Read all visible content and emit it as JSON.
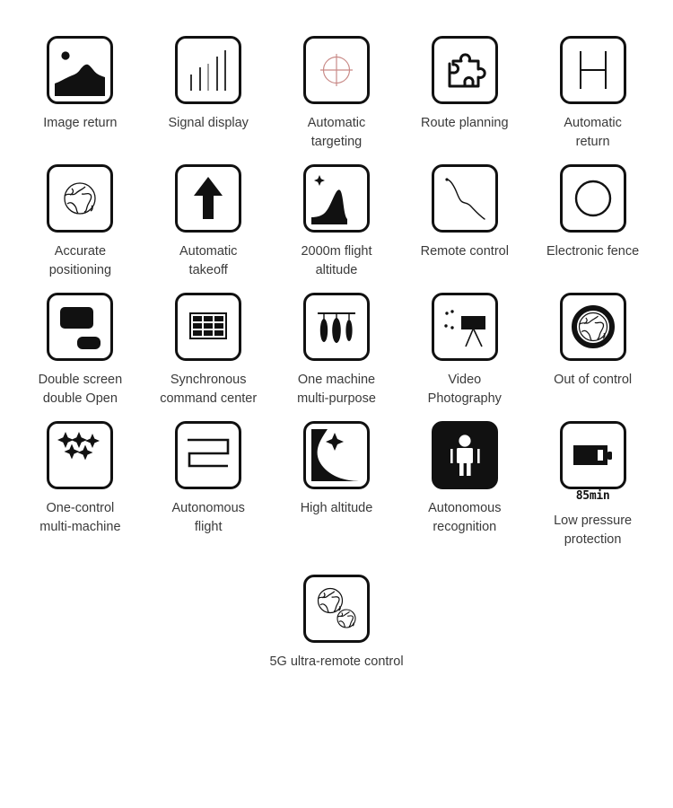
{
  "page": {
    "background": "#ffffff",
    "stroke_color": "#111111",
    "label_color": "#3a3a3a",
    "accent_color": "#c98b88"
  },
  "features": [
    {
      "id": "image-return",
      "icon": "image-return-icon",
      "label": "Image return"
    },
    {
      "id": "signal-display",
      "icon": "signal-display-icon",
      "label": "Signal display"
    },
    {
      "id": "automatic-targeting",
      "icon": "crosshair-target-icon",
      "label": "Automatic\ntargeting"
    },
    {
      "id": "route-planning",
      "icon": "puzzle-piece-icon",
      "label": "Route planning"
    },
    {
      "id": "automatic-return",
      "icon": "helipad-h-icon",
      "label": "Automatic\nreturn"
    },
    {
      "id": "accurate-positioning",
      "icon": "globe-icon",
      "label": "Accurate\npositioning"
    },
    {
      "id": "automatic-takeoff",
      "icon": "up-arrow-icon",
      "label": "Automatic\ntakeoff"
    },
    {
      "id": "flight-altitude",
      "icon": "mountain-star-icon",
      "label": "2000m flight\naltitude"
    },
    {
      "id": "remote-control",
      "icon": "descending-curve-icon",
      "label": "Remote control"
    },
    {
      "id": "electronic-fence",
      "icon": "circle-fence-icon",
      "label": "Electronic fence"
    },
    {
      "id": "double-screen",
      "icon": "double-screen-icon",
      "label": "Double screen\ndouble Open"
    },
    {
      "id": "command-center",
      "icon": "grid-panel-icon",
      "label": "Synchronous\ncommand center"
    },
    {
      "id": "multi-purpose",
      "icon": "hanging-pods-icon",
      "label": "One machine\nmulti-purpose"
    },
    {
      "id": "video-photography",
      "icon": "tripod-camera-icon",
      "label": "Video\nPhotography"
    },
    {
      "id": "out-of-control",
      "icon": "globe-ring-icon",
      "label": "Out of control"
    },
    {
      "id": "multi-machine",
      "icon": "drone-swarm-icon",
      "label": "One-control\nmulti-machine"
    },
    {
      "id": "autonomous-flight",
      "icon": "serpentine-path-icon",
      "label": "Autonomous\nflight"
    },
    {
      "id": "high-altitude",
      "icon": "cliff-star-icon",
      "label": "High altitude"
    },
    {
      "id": "autonomous-recognition",
      "icon": "person-detect-icon",
      "label": "Autonomous\nrecognition",
      "inverted": true
    },
    {
      "id": "low-pressure",
      "icon": "battery-icon",
      "label": "Low pressure\nprotection",
      "sub_label": "85min"
    },
    {
      "id": "5g-remote-control",
      "icon": "two-globes-icon",
      "label": "5G ultra-remote control"
    }
  ]
}
